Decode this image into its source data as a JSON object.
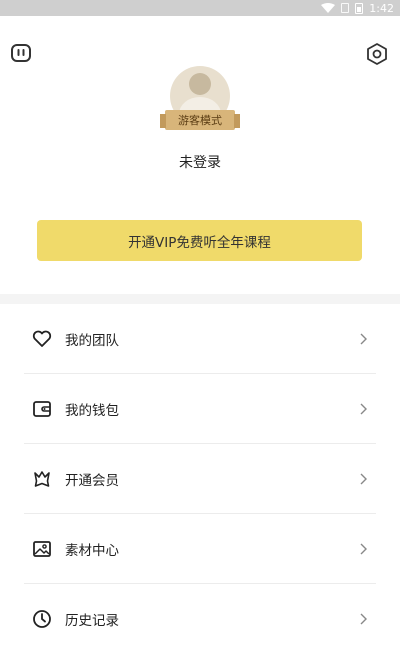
{
  "status_bar": {
    "time": "1:42",
    "icons": [
      "wifi-icon",
      "sim-icon",
      "battery-icon"
    ]
  },
  "header": {
    "left_icon": "message-icon",
    "right_icon": "settings-icon"
  },
  "profile": {
    "badge": "游客模式",
    "status": "未登录"
  },
  "vip_button": {
    "label": "开通VIP免费听全年课程",
    "color": "#f0da6a"
  },
  "menu": [
    {
      "label": "我的团队",
      "icon": "heart-icon"
    },
    {
      "label": "我的钱包",
      "icon": "wallet-icon"
    },
    {
      "label": "开通会员",
      "icon": "crown-icon"
    },
    {
      "label": "素材中心",
      "icon": "image-icon"
    },
    {
      "label": "历史记录",
      "icon": "clock-icon"
    }
  ]
}
